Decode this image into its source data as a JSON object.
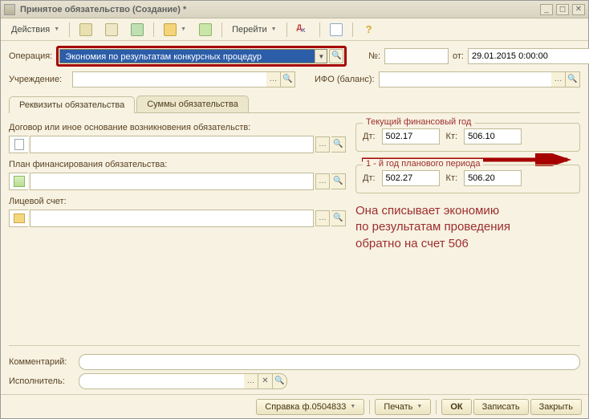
{
  "window": {
    "title": "Принятое обязательство (Создание) *"
  },
  "toolbar": {
    "actions": "Действия",
    "goto": "Перейти"
  },
  "header": {
    "op_label": "Операция:",
    "op_value": "Экономия по результатам конкурсных процедур",
    "num_label": "№:",
    "num_value": "",
    "from_label": "от:",
    "date_value": "29.01.2015 0:00:00",
    "org_label": "Учреждение:",
    "org_value": "",
    "ifo_label": "ИФО (баланс):",
    "ifo_value": ""
  },
  "tabs": [
    {
      "label": "Реквизиты обязательства"
    },
    {
      "label": "Суммы обязательства"
    }
  ],
  "left": {
    "contract_label": "Договор или иное основание возникновения обязательств:",
    "plan_label": "План финансирования обязательства:",
    "account_label": "Лицевой счет:"
  },
  "right": {
    "box1_title": "Текущий финансовый год",
    "box2_title": "1 - й год планового периода",
    "dt": "Дт:",
    "kt": "Кт:",
    "dt1": "502.17",
    "kt1": "506.10",
    "dt2": "502.27",
    "kt2": "506.20",
    "note1": "Она списывает экономию",
    "note2": "по результатам проведения",
    "note3": "обратно на счет 506"
  },
  "bottom": {
    "comment_label": "Комментарий:",
    "exec_label": "Исполнитель:"
  },
  "footer": {
    "ref": "Справка ф.0504833",
    "print": "Печать",
    "ok": "ОК",
    "save": "Записать",
    "close": "Закрыть"
  }
}
